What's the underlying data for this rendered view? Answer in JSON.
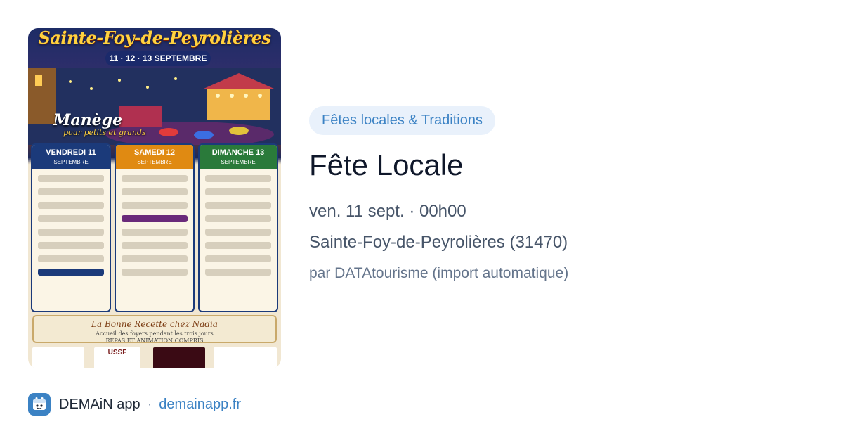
{
  "poster": {
    "title": "Sainte-Foy-de-Peyrolières",
    "dates": "11 · 12 · 13 SEPTEMBRE",
    "manege": "Manège",
    "manege_sub": "pour petits et grands",
    "days": [
      {
        "name": "VENDREDI 11",
        "sub": "SEPTEMBRE",
        "color": "#1b3a7a"
      },
      {
        "name": "SAMEDI 12",
        "sub": "SEPTEMBRE",
        "color": "#e08a12"
      },
      {
        "name": "DIMANCHE 13",
        "sub": "SEPTEMBRE",
        "color": "#2a7a3a"
      }
    ],
    "bottom_title": "La Bonne Recette chez Nadia",
    "bottom_sub": "Accueil des foyers pendant les trois jours",
    "bottom_sub2": "REPAS ET ANIMATION COMPRIS",
    "logo_text": "USSF"
  },
  "event": {
    "category": "Fêtes locales & Traditions",
    "title": "Fête Locale",
    "date": "ven. 11 sept. · 00h00",
    "place": "Sainte-Foy-de-Peyrolières (31470)",
    "author": "par DATAtourisme (import automatique)"
  },
  "footer": {
    "app_name": "DEMAiN app",
    "separator": "·",
    "domain": "demainapp.fr"
  },
  "colors": {
    "accent": "#3b82c4",
    "category_bg": "#e9f1fb",
    "title": "#0f172a",
    "meta": "#475569",
    "muted": "#64748b"
  }
}
